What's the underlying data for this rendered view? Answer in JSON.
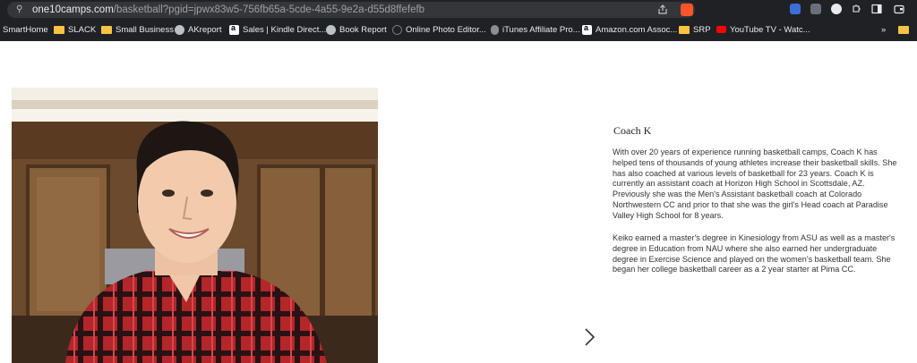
{
  "browser": {
    "url_domain": "one10camps.com",
    "url_path": "/basketball?pgid=jpwx83w5-756fb65a-5cde-4a55-9e2a-d55d8ffefefb",
    "icons": [
      "site-info-icon",
      "share-icon",
      "brave-shields-icon",
      "bitwarden-icon",
      "extension-icon",
      "s-extension-icon",
      "puzzle-extensions-icon",
      "sidebar-icon",
      "wallet-icon"
    ]
  },
  "bookmarks": [
    {
      "label": "SmartHome",
      "icon": "none"
    },
    {
      "label": "SLACK",
      "icon": "folder-icon"
    },
    {
      "label": "Small Business",
      "icon": "folder-icon"
    },
    {
      "label": "AKreport",
      "icon": "globe-icon"
    },
    {
      "label": "Sales | Kindle Direct...",
      "icon": "amazon-icon"
    },
    {
      "label": "Book Report",
      "icon": "globe-icon"
    },
    {
      "label": "Online Photo Editor...",
      "icon": "photo-editor-icon"
    },
    {
      "label": "iTunes Affiliate Pro...",
      "icon": "apple-icon"
    },
    {
      "label": "Amazon.com Assoc...",
      "icon": "amazon-icon"
    },
    {
      "label": "SRP",
      "icon": "folder-icon"
    },
    {
      "label": "YouTube TV - Watc...",
      "icon": "youtube-icon"
    }
  ],
  "bookmarks_overflow": "»",
  "coach": {
    "name": "Coach K",
    "bio_p1": "With over 20 years of experience running basketball camps, Coach K has helped tens of thousands of young athletes increase their basketball skills. She has also coached at various levels of basketball for 23 years. Coach K is currently an assistant coach at Horizon High School in Scottsdale, AZ.  Previously she was the Men's Assistant basketball coach at Colorado Northwestern CC and prior to that she was the girl's Head coach at Paradise Valley High School for 8 years.",
    "bio_p2": "Keiko earned a master's degree in Kinesiology from ASU as well as a master's degree in Education from NAU where she also earned her undergraduate degree in Exercise Science and played on the women's basketball team.  She began her college basketball career as a 2 year starter at Pima CC."
  },
  "colors": {
    "chrome_bg": "#202124",
    "urlbar_bg": "#35363a",
    "folder": "#f6c343",
    "brave": "#fb542b"
  }
}
